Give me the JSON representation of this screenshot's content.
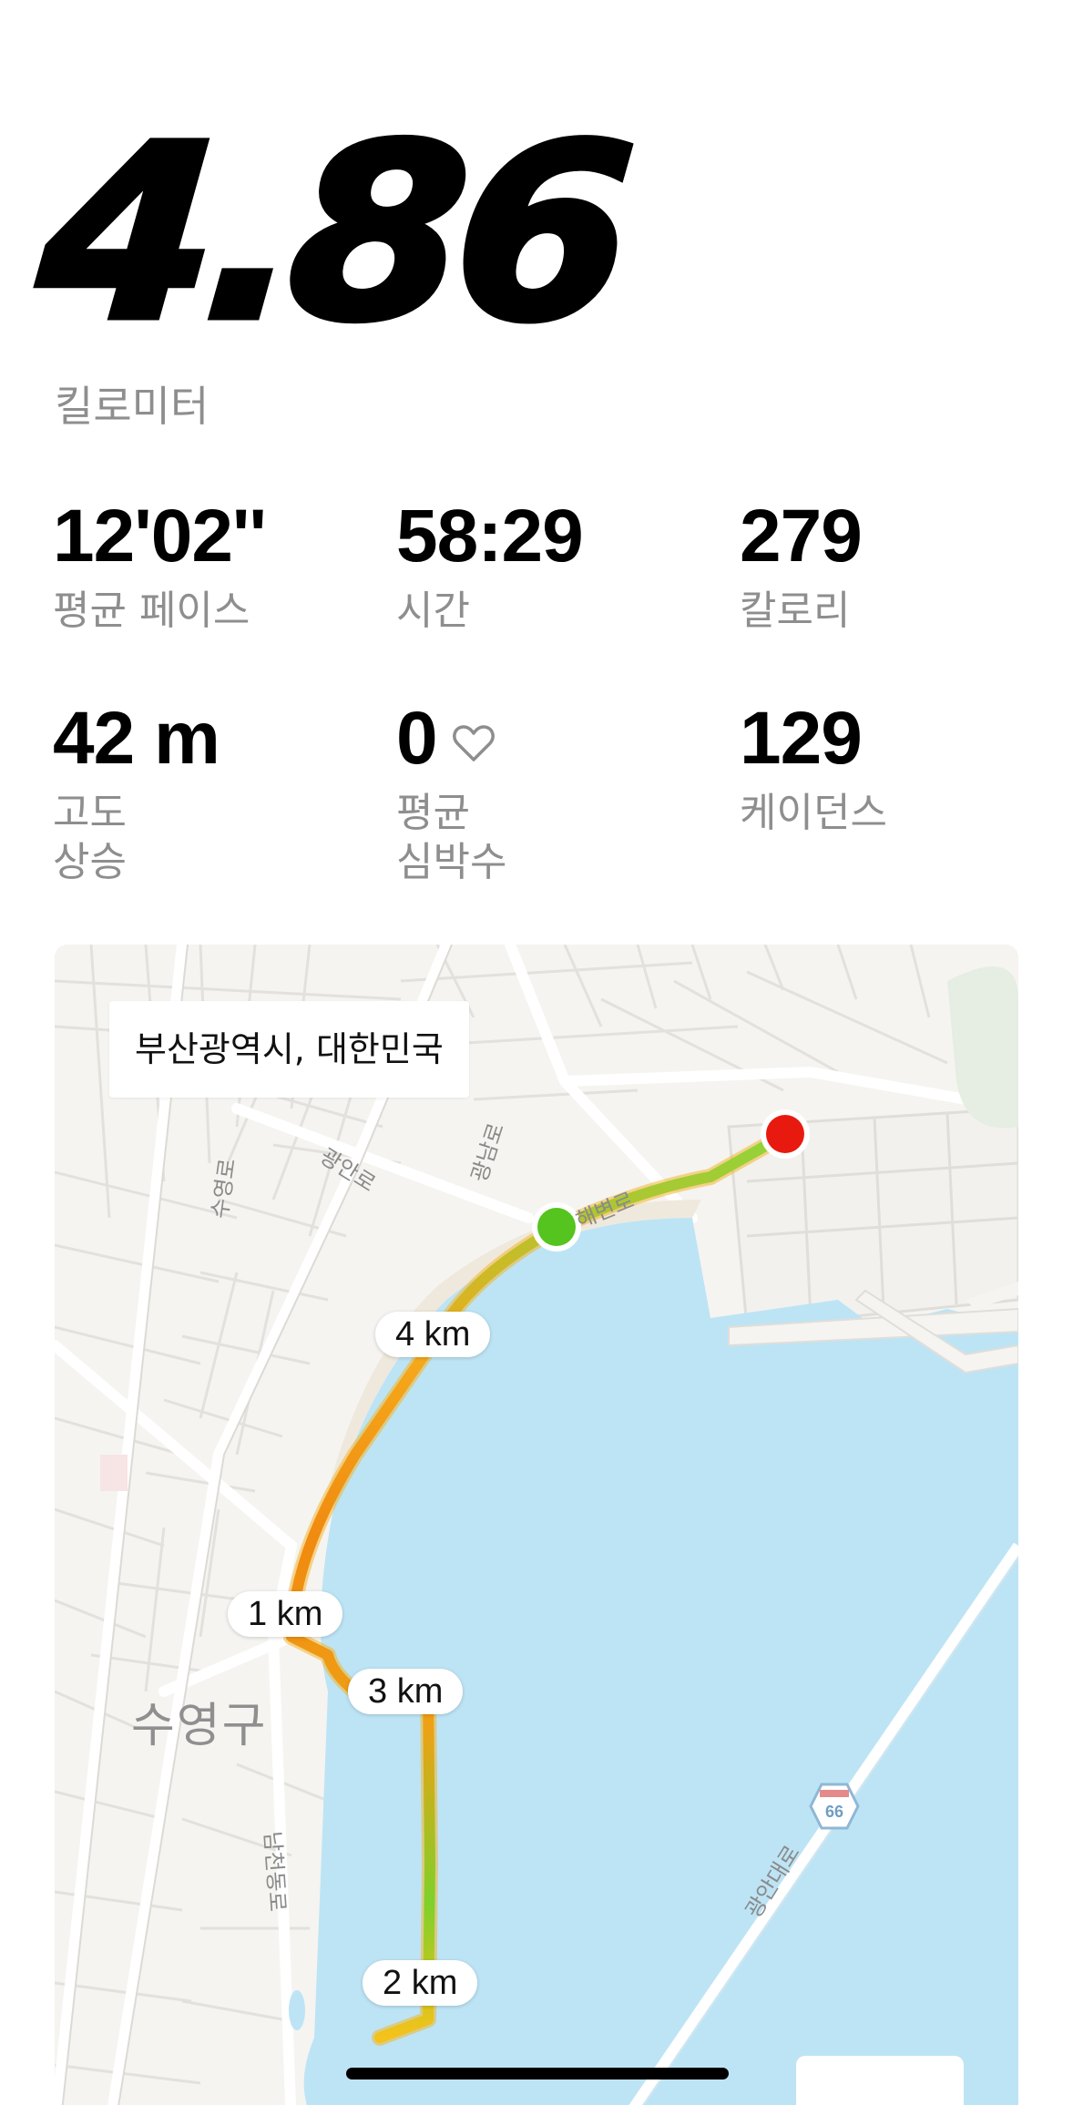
{
  "summary": {
    "distance": "4.86",
    "distance_unit": "킬로미터"
  },
  "stats": [
    {
      "value": "12'02''",
      "label": "평균 페이스"
    },
    {
      "value": "58:29",
      "label": "시간"
    },
    {
      "value": "279",
      "label": "칼로리"
    },
    {
      "value": "42 m",
      "label": "고도\n상승"
    },
    {
      "value": "0",
      "label": "평균\n심박수",
      "icon": "heart-outline-icon"
    },
    {
      "value": "129",
      "label": "케이던스"
    }
  ],
  "map": {
    "location": "부산광역시, 대한민국",
    "km_markers": [
      "4 km",
      "1 km",
      "3 km",
      "2 km"
    ],
    "road_labels": [
      "광안로",
      "광남로",
      "수영로",
      "해변로",
      "남천동로",
      "광안대로"
    ],
    "district_label": "수영구",
    "highway_number": "66",
    "colors": {
      "water": "#bde4f5",
      "land": "#f5f4f1",
      "start_marker": "#55c41e",
      "end_marker": "#e81a10",
      "route_slow": "#f08a10",
      "route_mid": "#f5c21a",
      "route_fast": "#7fd02a"
    }
  }
}
